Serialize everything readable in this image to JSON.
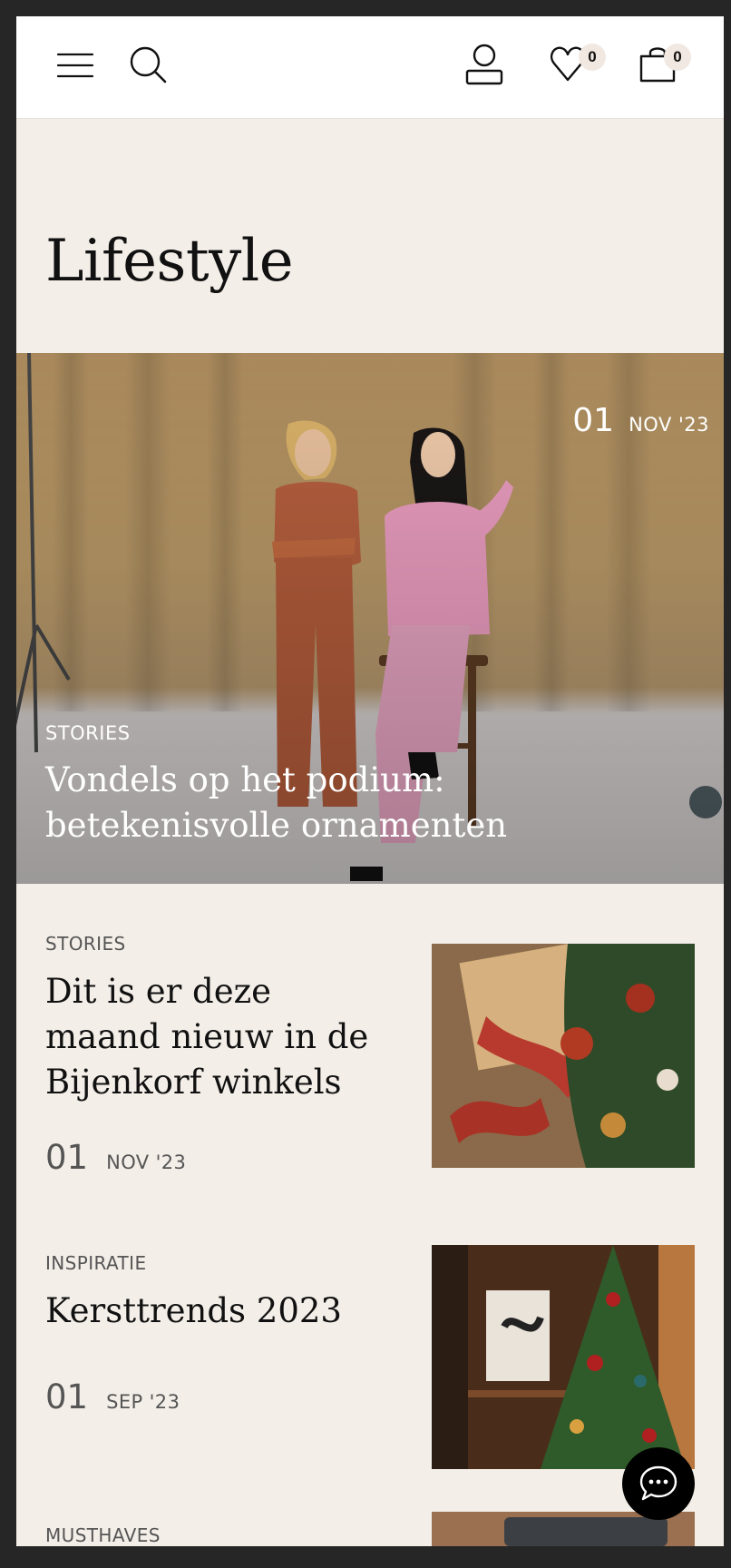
{
  "header": {
    "wishlist_count": "0",
    "cart_count": "0"
  },
  "page": {
    "title": "Lifestyle"
  },
  "hero": {
    "day": "01",
    "month": "NOV '23",
    "category": "STORIES",
    "title": "Vondels op het podium: betekenisvolle ornamenten"
  },
  "articles": [
    {
      "category": "STORIES",
      "title": "Dit is er deze maand nieuw in de Bijenkorf winkels",
      "day": "01",
      "month": "NOV '23"
    },
    {
      "category": "INSPIRATIE",
      "title": "Kersttrends 2023",
      "day": "01",
      "month": "SEP '23"
    },
    {
      "category": "MUSTHAVES"
    }
  ],
  "colors": {
    "background": "#f4eee8",
    "header": "#ffffff",
    "badge": "#f1e8e1",
    "chat_button": "#000000"
  },
  "icons": [
    "menu-icon",
    "search-icon",
    "account-icon",
    "heart-icon",
    "bag-icon",
    "chat-icon"
  ]
}
